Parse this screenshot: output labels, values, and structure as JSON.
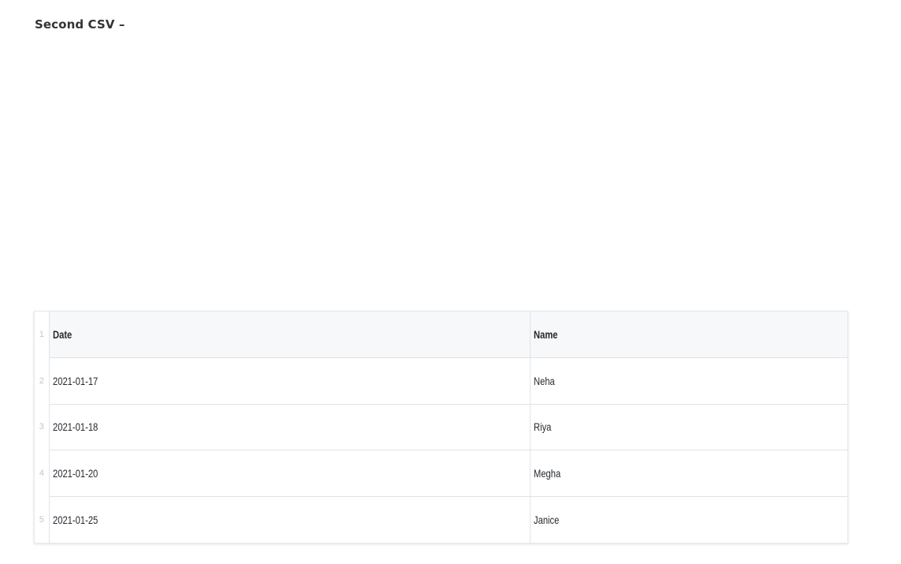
{
  "heading": "Second CSV –",
  "csv": {
    "columns": [
      "Date",
      "Name"
    ],
    "rows": [
      {
        "line": "2",
        "date": "2021-01-17",
        "name": "Neha"
      },
      {
        "line": "3",
        "date": "2021-01-18",
        "name": "Riya"
      },
      {
        "line": "4",
        "date": "2021-01-20",
        "name": "Megha"
      },
      {
        "line": "5",
        "date": "2021-01-25",
        "name": "Janice"
      }
    ],
    "header_line": "1"
  }
}
